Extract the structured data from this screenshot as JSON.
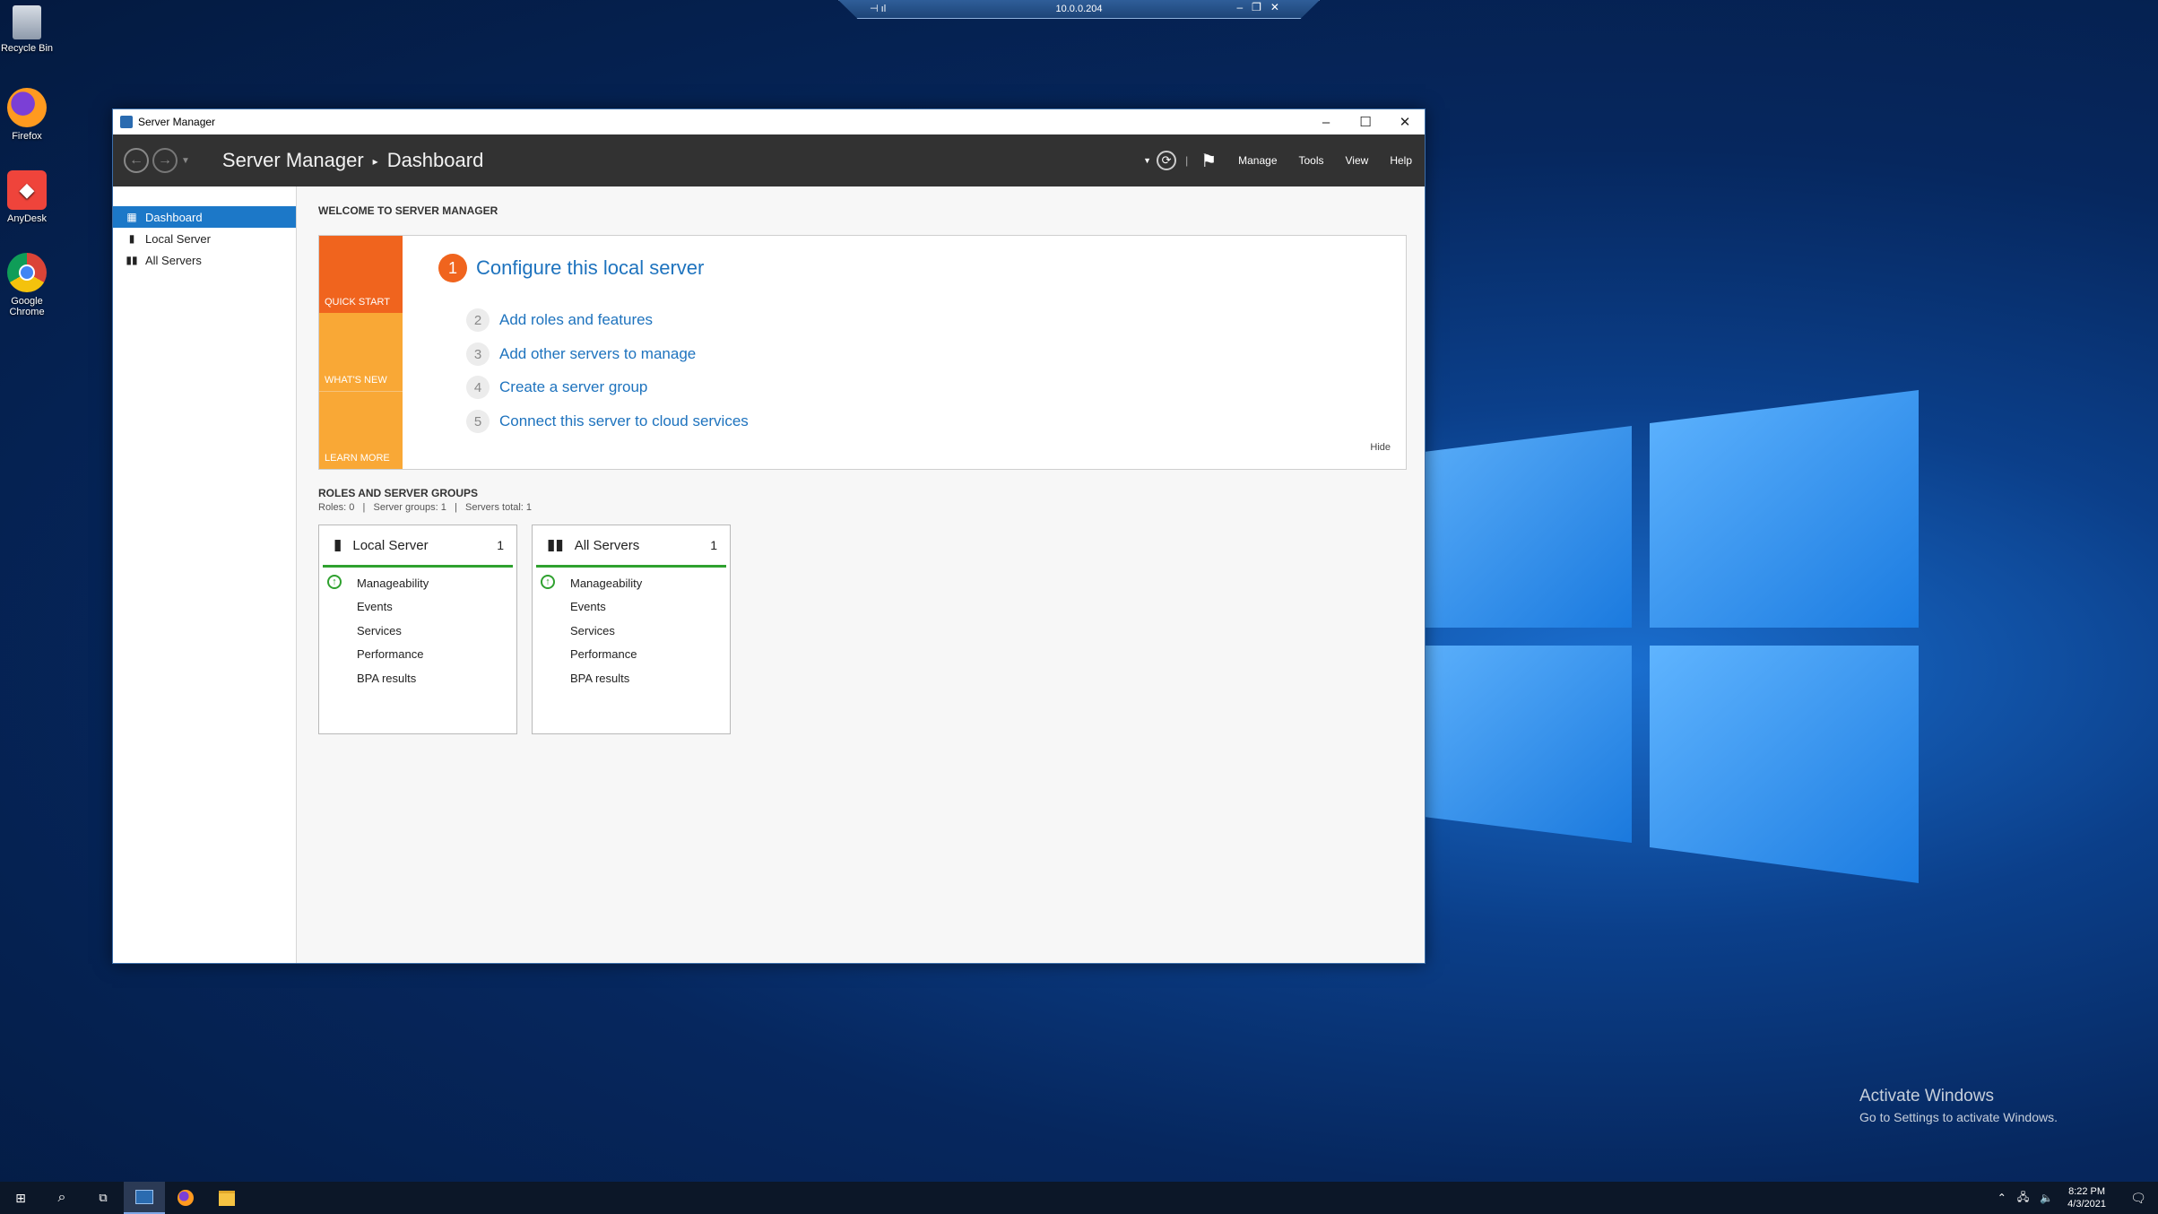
{
  "desktop": {
    "icons": [
      {
        "label": "Recycle Bin"
      },
      {
        "label": "Firefox"
      },
      {
        "label": "AnyDesk"
      },
      {
        "label": "Google Chrome"
      }
    ],
    "watermark": {
      "line1": "Activate Windows",
      "line2": "Go to Settings to activate Windows."
    }
  },
  "rdp_bar": {
    "host": "10.0.0.204"
  },
  "window": {
    "title": "Server Manager",
    "controls": {
      "minimize": "–",
      "maximize": "☐",
      "close": "✕"
    }
  },
  "toolbar": {
    "breadcrumb": {
      "root": "Server Manager",
      "separator": "▸",
      "current": "Dashboard"
    },
    "menus": [
      "Manage",
      "Tools",
      "View",
      "Help"
    ]
  },
  "sidebar": {
    "items": [
      {
        "label": "Dashboard",
        "active": true
      },
      {
        "label": "Local Server",
        "active": false
      },
      {
        "label": "All Servers",
        "active": false
      }
    ]
  },
  "welcome": {
    "title": "WELCOME TO SERVER MANAGER",
    "tiles": [
      "QUICK START",
      "WHAT'S NEW",
      "LEARN MORE"
    ],
    "primary_step": {
      "number": "1",
      "label": "Configure this local server"
    },
    "steps": [
      {
        "number": "2",
        "label": "Add roles and features"
      },
      {
        "number": "3",
        "label": "Add other servers to manage"
      },
      {
        "number": "4",
        "label": "Create a server group"
      },
      {
        "number": "5",
        "label": "Connect this server to cloud services"
      }
    ],
    "hide_label": "Hide"
  },
  "roles": {
    "title": "ROLES AND SERVER GROUPS",
    "stats": "Roles: 0   |   Server groups: 1   |   Servers total: 1",
    "cards": [
      {
        "name": "Local Server",
        "count": "1",
        "rows": [
          "Manageability",
          "Events",
          "Services",
          "Performance",
          "BPA results"
        ]
      },
      {
        "name": "All Servers",
        "count": "1",
        "rows": [
          "Manageability",
          "Events",
          "Services",
          "Performance",
          "BPA results"
        ]
      }
    ]
  },
  "taskbar": {
    "time": "8:22 PM",
    "date": "4/3/2021"
  },
  "colors": {
    "accent": "#1c78c8",
    "quick_start": "#f0641e",
    "tile_orange": "#f9a836",
    "status_green": "#2fa12f",
    "toolbar": "#323232"
  }
}
